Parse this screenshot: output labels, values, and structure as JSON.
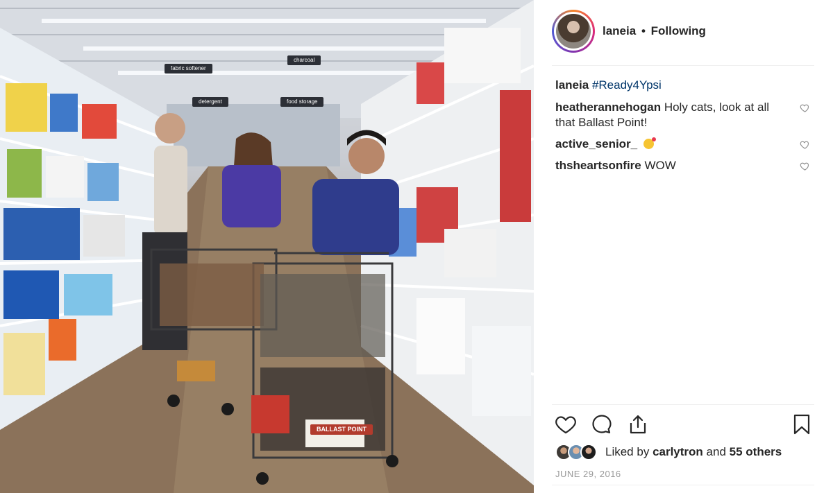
{
  "photo": {
    "aisle_signs": [
      "fabric softener",
      "charcoal",
      "detergent",
      "food storage"
    ],
    "cart_product_label": "BALLAST POINT"
  },
  "post": {
    "username": "laneia",
    "separator": "•",
    "follow_status": "Following",
    "caption": {
      "username": "laneia",
      "hashtag": "#Ready4Ypsi"
    },
    "comments": [
      {
        "username": "heatheranneho​gan",
        "text": "Holy cats, look at all that Ballast Point!"
      },
      {
        "username": "active_senior_",
        "text": "",
        "emoji": "kissing-face-emoji"
      },
      {
        "username": "thsheartsonfire",
        "text": "WOW"
      }
    ],
    "likes": {
      "prefix": "Liked by",
      "user": "carlytron",
      "joiner": "and",
      "others": "55 others"
    },
    "date": "JUNE 29, 2016"
  },
  "icons": {
    "like": "heart-icon",
    "comment": "comment-bubble-icon",
    "share": "share-upload-icon",
    "save": "bookmark-icon",
    "comment_like": "heart-outline-icon"
  },
  "colors": {
    "text": "#262626",
    "hashtag": "#003569",
    "muted": "#999999",
    "divider": "#efefef"
  }
}
